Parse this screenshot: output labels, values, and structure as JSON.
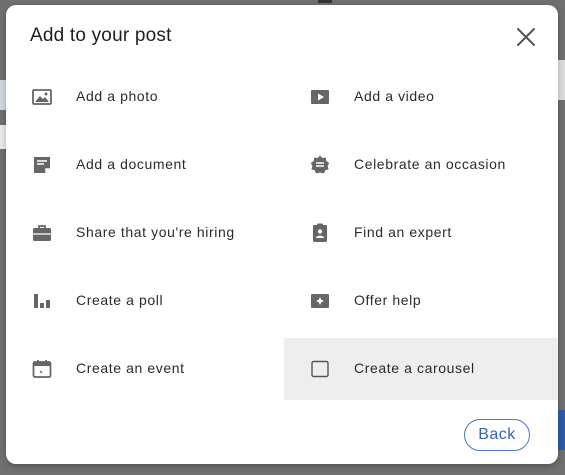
{
  "dialog": {
    "title": "Add to your post",
    "back_label": "Back",
    "options": [
      {
        "label": "Add a photo",
        "icon": "photo-icon"
      },
      {
        "label": "Add a video",
        "icon": "video-icon"
      },
      {
        "label": "Add a document",
        "icon": "document-icon"
      },
      {
        "label": "Celebrate an occasion",
        "icon": "celebrate-icon"
      },
      {
        "label": "Share that you're hiring",
        "icon": "briefcase-icon"
      },
      {
        "label": "Find an expert",
        "icon": "expert-badge-icon"
      },
      {
        "label": "Create a poll",
        "icon": "poll-icon"
      },
      {
        "label": "Offer help",
        "icon": "offer-help-icon"
      },
      {
        "label": "Create an event",
        "icon": "calendar-icon"
      },
      {
        "label": "Create a carousel",
        "icon": "carousel-icon",
        "selected": true
      }
    ]
  },
  "colors": {
    "accent": "#3465b8",
    "icon": "#666666",
    "text": "#2b2b2b",
    "hover": "#eeeeee"
  }
}
